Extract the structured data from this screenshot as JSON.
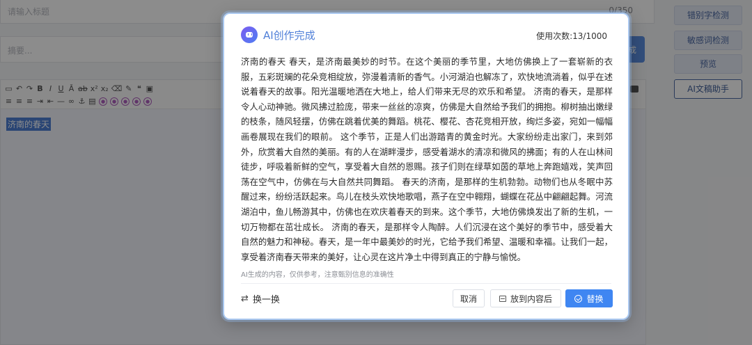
{
  "page": {
    "title_placeholder": "请输入标题",
    "title_count": "0/350",
    "summary_placeholder": "摘要...",
    "gen_button": "成",
    "editor_text": "济南的春天"
  },
  "side_buttons": [
    {
      "label": "错别字检测"
    },
    {
      "label": "敏感词检测"
    },
    {
      "label": "预览"
    },
    {
      "label": "AI文稿助手"
    }
  ],
  "dialog": {
    "title": "AI创作完成",
    "usage": "使用次数:13/1000",
    "content": "济南的春天 春天，是济南最美妙的时节。在这个美丽的季节里，大地仿佛换上了一套崭新的衣服，五彩斑斓的花朵竞相绽放，弥漫着清新的香气。小河湖泊也解冻了，欢快地流淌着，似乎在述说着春天的故事。阳光温暖地洒在大地上，给人们带来无尽的欢乐和希望。 济南的春天，是那样令人心动神驰。微风拂过脸庞，带来一丝丝的凉爽，仿佛是大自然给予我们的拥抱。柳树抽出嫩绿的枝条，随风轻摆，仿佛在跳着优美的舞蹈。桃花、樱花、杏花竞相开放，绚烂多姿，宛如一幅幅画卷展现在我们的眼前。 这个季节，正是人们出游踏青的黄金时光。大家纷纷走出家门，来到郊外，欣赏着大自然的美丽。有的人在湖畔漫步，感受着湖水的清凉和微风的拂面；有的人在山林间徒步，呼吸着新鲜的空气，享受着大自然的恩赐。孩子们则在绿草如茵的草地上奔跑嬉戏，笑声回荡在空气中，仿佛在与大自然共同舞蹈。 春天的济南，是那样的生机勃勃。动物们也从冬眠中苏醒过来，纷纷活跃起来。鸟儿在枝头欢快地歌唱，燕子在空中翱翔，蝴蝶在花丛中翩翩起舞。河流湖泊中，鱼儿畅游其中，仿佛也在欢庆着春天的到来。这个季节，大地仿佛焕发出了新的生机，一切万物都在茁壮成长。 济南的春天，是那样令人陶醉。人们沉浸在这个美好的季节中，感受着大自然的魅力和神秘。春天，是一年中最美妙的时光，它给予我们希望、温暖和幸福。让我们一起，享受着济南春天带来的美好，让心灵在这片净土中得到真正的宁静与愉悦。",
    "disclaimer": "AI生成的内容，仅供参考，注意甄别信息的准确性",
    "swap_label": "换一换",
    "cancel_label": "取消",
    "append_label": "放到内容后",
    "replace_label": "替换"
  },
  "colors": {
    "accent": "#3f86f2",
    "title": "#4f7fd8"
  },
  "icons": [
    "ai-bot-icon",
    "swap-icon",
    "file-icon",
    "check-circle-icon"
  ]
}
